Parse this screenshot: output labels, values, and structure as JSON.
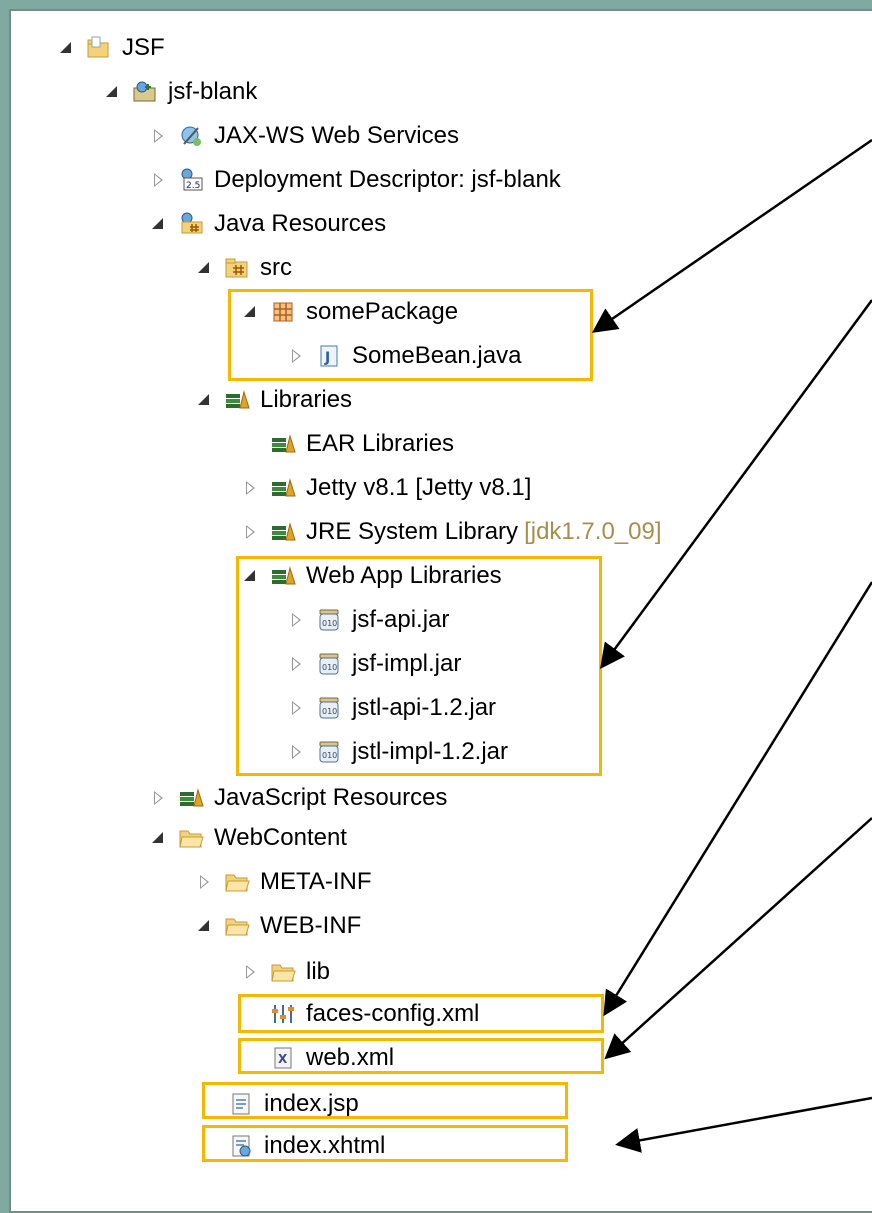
{
  "tree": {
    "root": {
      "label": "JSF"
    },
    "project": {
      "label": "jsf-blank"
    },
    "items": {
      "jaxws": {
        "label": "JAX-WS Web Services"
      },
      "deploy": {
        "label": "Deployment Descriptor: jsf-blank"
      },
      "javares": {
        "label": "Java Resources"
      },
      "src": {
        "label": "src"
      },
      "somepackage": {
        "label": "somePackage"
      },
      "somebean": {
        "label": "SomeBean.java"
      },
      "libraries": {
        "label": "Libraries"
      },
      "ear": {
        "label": "EAR Libraries"
      },
      "jetty": {
        "label": "Jetty v8.1 [Jetty v8.1]"
      },
      "jre": {
        "label": "JRE System Library",
        "suffix": "[jdk1.7.0_09]"
      },
      "webapplibs": {
        "label": "Web App Libraries"
      },
      "jsfapi": {
        "label": "jsf-api.jar"
      },
      "jsfimpl": {
        "label": "jsf-impl.jar"
      },
      "jstlapi": {
        "label": "jstl-api-1.2.jar"
      },
      "jstlimpl": {
        "label": "jstl-impl-1.2.jar"
      },
      "jsres": {
        "label": "JavaScript Resources"
      },
      "webcontent": {
        "label": "WebContent"
      },
      "metainf": {
        "label": "META-INF"
      },
      "webinf": {
        "label": "WEB-INF"
      },
      "lib": {
        "label": "lib"
      },
      "facesconfig": {
        "label": "faces-config.xml"
      },
      "webxml": {
        "label": "web.xml"
      },
      "indexjsp": {
        "label": "index.jsp"
      },
      "indexxhtml": {
        "label": "index.xhtml"
      }
    }
  },
  "colors": {
    "highlight": "#f5b800",
    "background": "#7fa9a1",
    "suffix": "#a88e4c"
  }
}
